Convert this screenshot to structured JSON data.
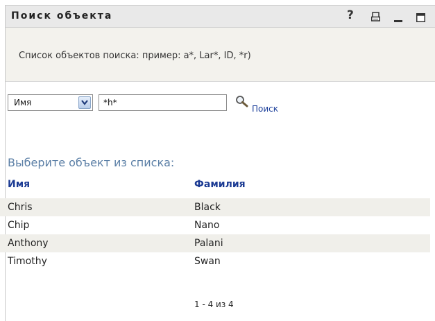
{
  "window": {
    "title": "Поиск объекта",
    "help_label": "?"
  },
  "info": {
    "text": "Список объектов поиска: пример: a*, Lar*, ID, *r)"
  },
  "search": {
    "field_selected": "Имя",
    "query_value": "*h*",
    "search_label": "Поиск"
  },
  "results": {
    "title": "Выберите объект из списка:",
    "columns": [
      "Имя",
      "Фамилия"
    ],
    "rows": [
      [
        "Chris",
        "Black"
      ],
      [
        "Chip",
        "Nano"
      ],
      [
        "Anthony",
        "Palani"
      ],
      [
        "Timothy",
        "Swan"
      ]
    ],
    "pager": "1 - 4 из 4"
  },
  "icons": {
    "help": "question-mark-icon",
    "print": "print-icon",
    "minimize": "minimize-icon",
    "maximize": "maximize-icon",
    "dropdown": "chevron-down-icon",
    "search": "magnifier-icon"
  },
  "colors": {
    "title_bar": "#e9e9e9",
    "info_bar": "#f3f2ed",
    "link": "#1a3d9a",
    "column_header": "#1b3a93",
    "list_title": "#5b7fa6",
    "row_shade": "#f0efea"
  }
}
